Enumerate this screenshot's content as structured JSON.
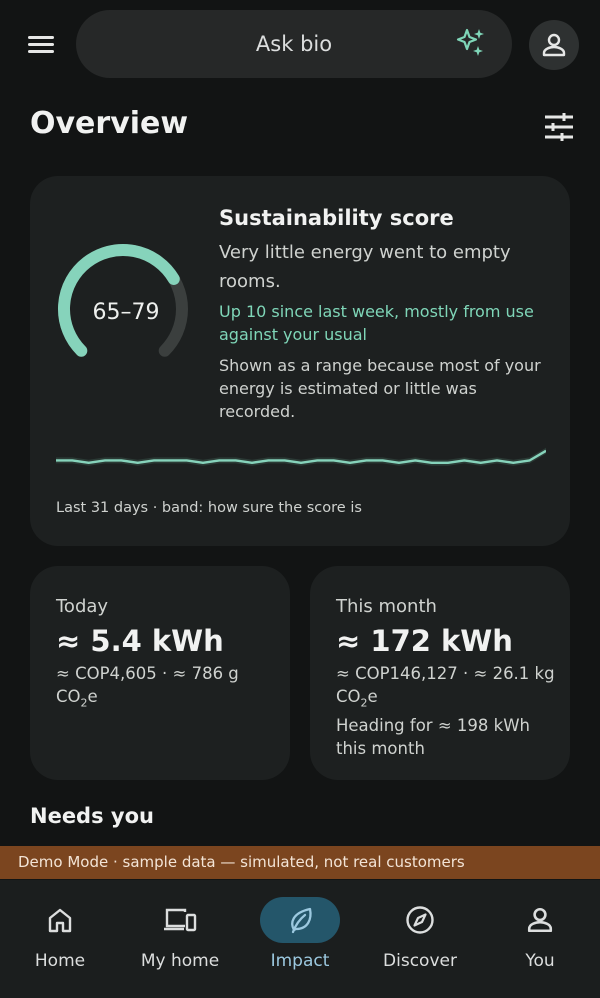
{
  "header": {
    "search_placeholder": "Ask bio"
  },
  "page": {
    "title": "Overview"
  },
  "score_card": {
    "title": "Sustainability score",
    "range": "65–79",
    "gauge_fraction": 0.72,
    "description": "Very little energy went to empty rooms.",
    "change": "Up 10 since last week, mostly from use against your usual",
    "note": "Shown as a range because most of your energy is estimated or little was recorded.",
    "caption": "Last 31 days · band: how sure the score is",
    "trend": [
      70,
      70,
      69,
      70,
      70,
      69,
      70,
      70,
      70,
      69,
      70,
      70,
      69,
      70,
      70,
      69,
      70,
      70,
      69,
      70,
      70,
      69,
      70,
      69,
      69,
      70,
      69,
      70,
      69,
      70,
      74
    ]
  },
  "today": {
    "label": "Today",
    "value": "≈ 5.4 kWh",
    "detail_pre": "≈ COP4,605 · ≈ 786 g CO",
    "detail_sub": "2",
    "detail_post": "e"
  },
  "month": {
    "label": "This month",
    "value": "≈ 172 kWh",
    "detail_pre": "≈ COP146,127 · ≈ 26.1 kg CO",
    "detail_sub": "2",
    "detail_post": "e",
    "forecast": "Heading for ≈ 198 kWh this month"
  },
  "needs_title": "Needs you",
  "demo_banner": "Demo Mode · sample data — simulated, not real customers",
  "nav": {
    "items": [
      {
        "label": "Home",
        "icon": "home-icon"
      },
      {
        "label": "My home",
        "icon": "devices-icon"
      },
      {
        "label": "Impact",
        "icon": "leaf-icon"
      },
      {
        "label": "Discover",
        "icon": "compass-icon"
      },
      {
        "label": "You",
        "icon": "person-icon"
      }
    ],
    "active": "Impact"
  },
  "colors": {
    "accent": "#7fd6b8",
    "banner": "#7b451f",
    "nav_active": "#24566a",
    "card": "#1d2020"
  }
}
